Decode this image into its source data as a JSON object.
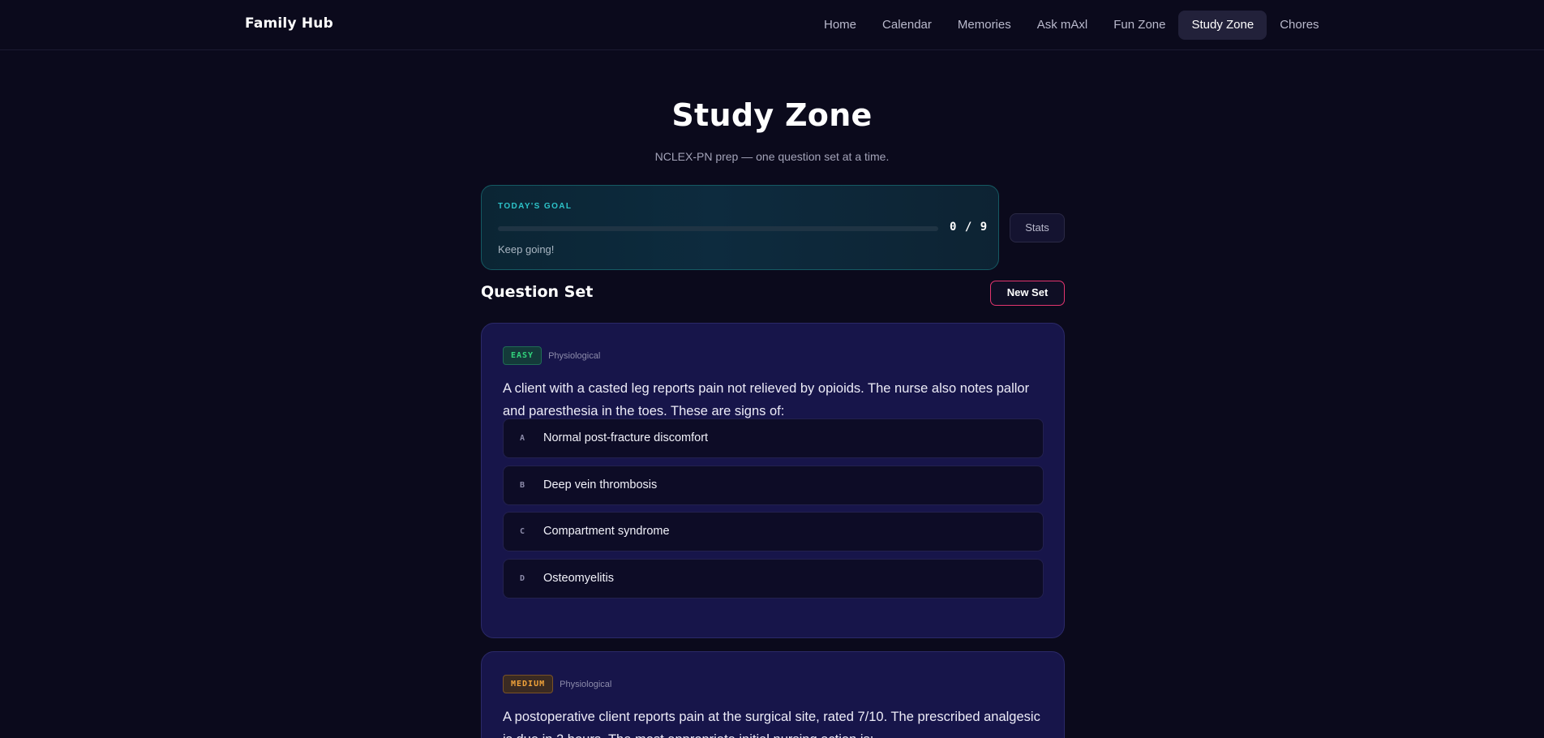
{
  "brand": "Family Hub",
  "nav": {
    "items": [
      {
        "label": "Home"
      },
      {
        "label": "Calendar"
      },
      {
        "label": "Memories"
      },
      {
        "label": "Ask mAxl"
      },
      {
        "label": "Fun Zone"
      },
      {
        "label": "Study Zone",
        "active": true
      },
      {
        "label": "Chores"
      }
    ]
  },
  "page": {
    "title": "Study Zone",
    "subtitle": "NCLEX-PN prep — one question set at a time."
  },
  "goal": {
    "label": "TODAY'S GOAL",
    "count": "0 / 9",
    "progress": 0,
    "note": "Keep going!"
  },
  "stats_label": "Stats",
  "question_set": {
    "title": "Question Set",
    "new_set_label": "New Set",
    "questions": [
      {
        "difficulty": "EASY",
        "category": "Physiological",
        "text": "A client with a casted leg reports pain not relieved by opioids. The nurse also notes pallor and paresthesia in the toes. These are signs of:",
        "options": [
          {
            "letter": "A",
            "text": "Normal post-fracture discomfort"
          },
          {
            "letter": "B",
            "text": "Deep vein thrombosis"
          },
          {
            "letter": "C",
            "text": "Compartment syndrome"
          },
          {
            "letter": "D",
            "text": "Osteomyelitis"
          }
        ]
      },
      {
        "difficulty": "MEDIUM",
        "category": "Physiological",
        "text": "A postoperative client reports pain at the surgical site, rated 7/10. The prescribed analgesic is due in 2 hours. The most appropriate initial nursing action is:"
      }
    ]
  },
  "colors": {
    "background": "#0b0a1c",
    "accent_teal": "#2dc3c9",
    "accent_pink": "#e2356e",
    "easy_green": "#32d47c",
    "medium_orange": "#f2a33a",
    "card": "#17154a"
  }
}
